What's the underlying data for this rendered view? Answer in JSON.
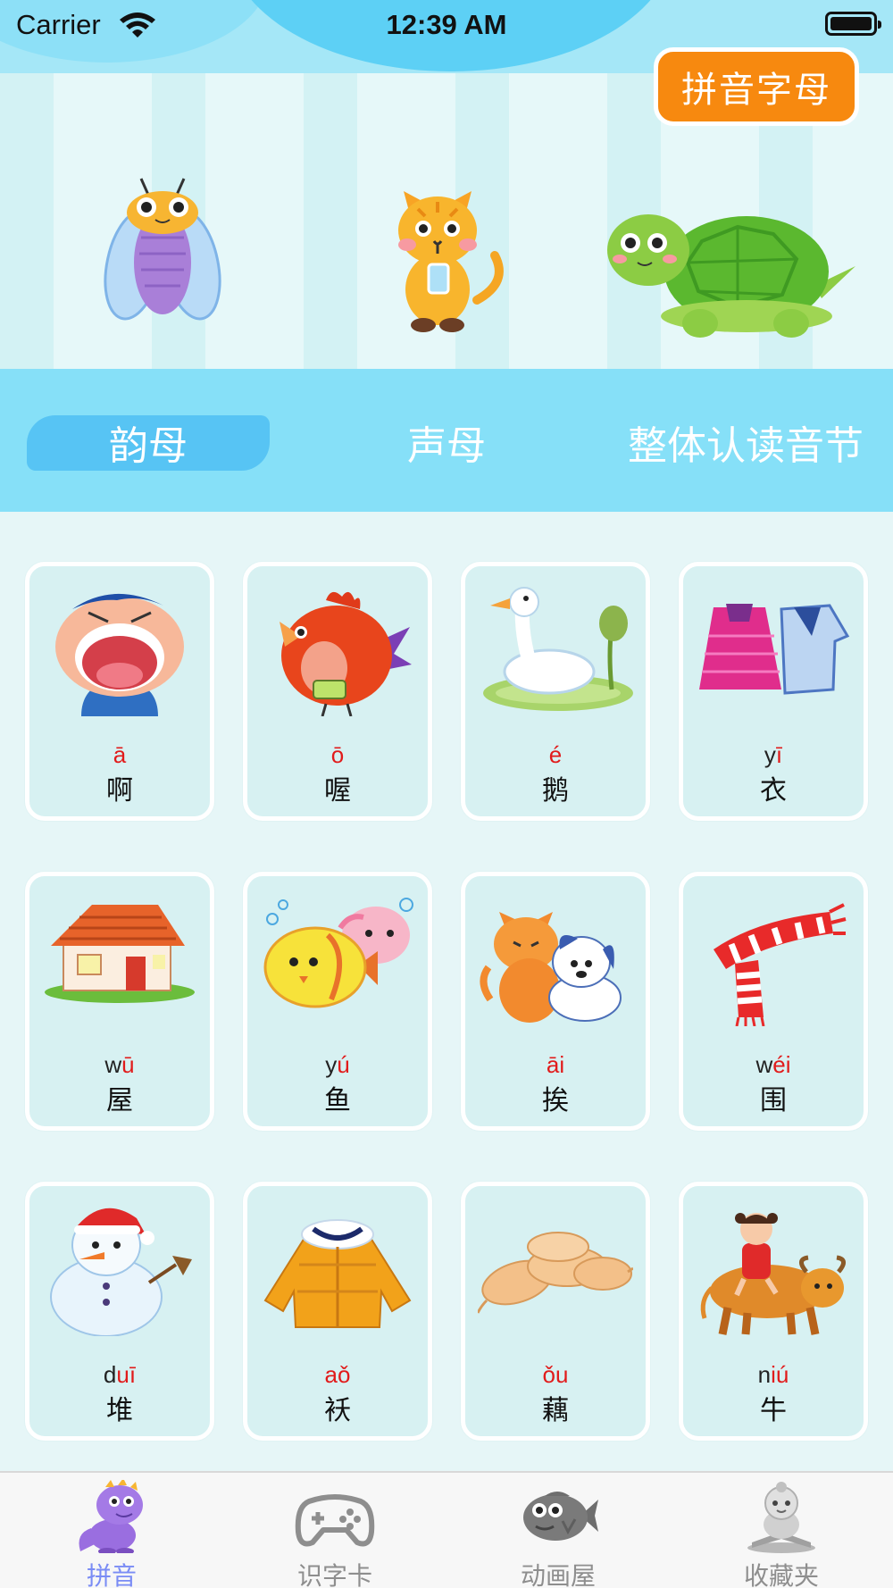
{
  "status_bar": {
    "carrier": "Carrier",
    "time": "12:39 AM"
  },
  "header": {
    "alphabet_button": "拼音字母",
    "mascots": [
      "cicada-icon",
      "cat-icon",
      "turtle-icon"
    ]
  },
  "tabs": [
    {
      "label": "韵母",
      "active": true
    },
    {
      "label": "声母",
      "active": false
    },
    {
      "label": "整体认读音节",
      "active": false
    }
  ],
  "cards": [
    {
      "pinyin_plain": "",
      "pinyin_tone": "ā",
      "pinyin_rest": "",
      "hanzi": "啊",
      "icon": "boy-open-mouth-icon"
    },
    {
      "pinyin_plain": "",
      "pinyin_tone": "ō",
      "pinyin_rest": "",
      "hanzi": "喔",
      "icon": "rooster-icon"
    },
    {
      "pinyin_plain": "",
      "pinyin_tone": "é",
      "pinyin_rest": "",
      "hanzi": "鹅",
      "icon": "goose-icon"
    },
    {
      "pinyin_plain": "y",
      "pinyin_tone": "ī",
      "pinyin_rest": "",
      "hanzi": "衣",
      "icon": "clothes-icon"
    },
    {
      "pinyin_plain": "w",
      "pinyin_tone": "ū",
      "pinyin_rest": "",
      "hanzi": "屋",
      "icon": "house-icon"
    },
    {
      "pinyin_plain": "y",
      "pinyin_tone": "ú",
      "pinyin_rest": "",
      "hanzi": "鱼",
      "icon": "fish-icon"
    },
    {
      "pinyin_plain": "",
      "pinyin_tone": "āi",
      "pinyin_rest": "",
      "hanzi": "挨",
      "icon": "cat-and-dog-icon"
    },
    {
      "pinyin_plain": "w",
      "pinyin_tone": "éi",
      "pinyin_rest": "",
      "hanzi": "围",
      "icon": "scarf-icon"
    },
    {
      "pinyin_plain": "d",
      "pinyin_tone": "uī",
      "pinyin_rest": "",
      "hanzi": "堆",
      "icon": "snowman-icon"
    },
    {
      "pinyin_plain": "",
      "pinyin_tone": "aǒ",
      "pinyin_rest": "",
      "hanzi": "袄",
      "icon": "coat-icon"
    },
    {
      "pinyin_plain": "",
      "pinyin_tone": "ǒu",
      "pinyin_rest": "",
      "hanzi": "藕",
      "icon": "lotus-root-icon"
    },
    {
      "pinyin_plain": "n",
      "pinyin_tone": "iú",
      "pinyin_rest": "",
      "hanzi": "牛",
      "icon": "girl-on-ox-icon"
    }
  ],
  "tab_bar": [
    {
      "label": "拼音",
      "icon": "dinosaur-icon",
      "active": true
    },
    {
      "label": "识字卡",
      "icon": "gamepad-icon",
      "active": false
    },
    {
      "label": "动画屋",
      "icon": "fish-icon",
      "active": false
    },
    {
      "label": "收藏夹",
      "icon": "reading-kid-icon",
      "active": false
    }
  ],
  "colors": {
    "accent_orange": "#f7890f",
    "tab_strip": "#86e0f8",
    "active_tab": "#7a8cf5",
    "tone_red": "#e11b1b"
  }
}
